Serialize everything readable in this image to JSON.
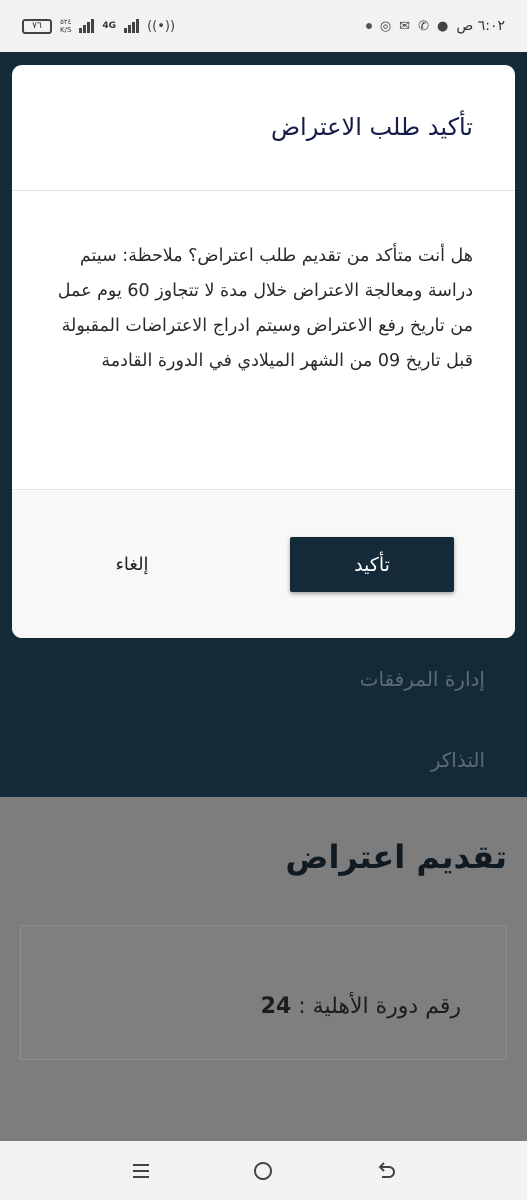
{
  "status_bar": {
    "battery": "٧٦",
    "speed_value": "٥٢٤",
    "speed_unit": "K/S",
    "network": "4G",
    "time": "٦:٠٢ ص"
  },
  "background": {
    "menu_items": [
      {
        "label": "إدارة المرفقات"
      },
      {
        "label": "التذاكر"
      }
    ],
    "page_title": "تقديم اعتراض",
    "eligibility_label": "رقم دورة الأهلية :",
    "eligibility_value": "24"
  },
  "modal": {
    "title": "تأكيد طلب الاعتراض",
    "body": "هل أنت متأكد من تقديم طلب اعتراض؟ ملاحظة: سيتم دراسة ومعالجة الاعتراض خلال مدة لا تتجاوز 60 يوم عمل من تاريخ رفع الاعتراض وسيتم ادراج الاعتراضات المقبولة قبل تاريخ 09 من الشهر الميلادي في الدورة القادمة",
    "confirm_label": "تأكيد",
    "cancel_label": "إلغاء"
  },
  "colors": {
    "primary_dark": "#142a38",
    "title_navy": "#141d4a"
  },
  "icons": {
    "nav": [
      "recent-apps-icon",
      "home-icon",
      "back-icon"
    ]
  }
}
